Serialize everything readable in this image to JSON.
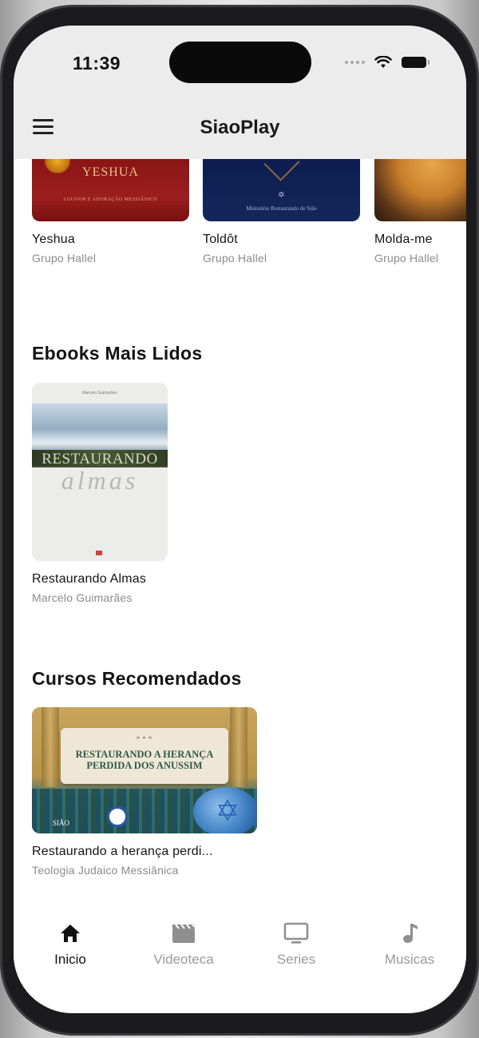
{
  "status_bar": {
    "time": "11:39"
  },
  "header": {
    "title": "SiaoPlay",
    "menu_icon": "hamburger-menu-icon"
  },
  "music_row": [
    {
      "title": "Yeshua",
      "artist": "Grupo Hallel",
      "cover_word": "YESHUA",
      "cover_small": "LOUVOR E ADORAÇÃO MESSIÂNICO"
    },
    {
      "title": "Toldôt",
      "artist": "Grupo Hallel",
      "cover_small": "Ministério Restaurando de Sião"
    },
    {
      "title": "Molda-me",
      "artist": "Grupo Hallel"
    }
  ],
  "ebooks": {
    "heading": "Ebooks Mais Lidos",
    "items": [
      {
        "title": "Restaurando Almas",
        "author": "Marcelo Guimarães",
        "cover_line1": "RESTAURANDO",
        "cover_line2": "almas"
      }
    ]
  },
  "courses": {
    "heading": "Cursos Recomendados",
    "items": [
      {
        "title": "Restaurando a herança perdi...",
        "subtitle": "Teologia Judaico Messiânica",
        "cover_text": "RESTAURANDO A HERANÇA PERDIDA DOS ANUSSIM",
        "cover_brand": "SIÃO"
      }
    ]
  },
  "bottom_nav": [
    {
      "label": "Inicio",
      "icon": "home-icon",
      "active": true
    },
    {
      "label": "Videoteca",
      "icon": "film-clapper-icon",
      "active": false
    },
    {
      "label": "Series",
      "icon": "tv-icon",
      "active": false
    },
    {
      "label": "Musicas",
      "icon": "music-note-icon",
      "active": false
    }
  ],
  "colors": {
    "active_nav": "#111111",
    "inactive_nav": "#9a9a9a",
    "topbar_bg": "#ececec"
  }
}
